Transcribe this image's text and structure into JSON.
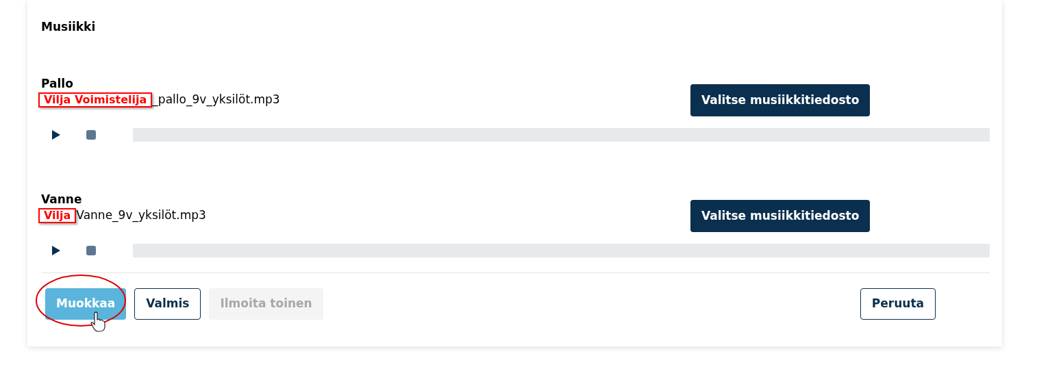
{
  "section_title": "Musiikki",
  "tracks": [
    {
      "label": "Pallo",
      "file_name": "_pallo_9v_yksilöt.mp3",
      "annotation": "Vilja Voimistelija",
      "choose_button": "Valitse musiikkitiedosto"
    },
    {
      "label": "Vanne",
      "file_name": "Vanne_9v_yksilöt.mp3",
      "annotation": "Vilja",
      "choose_button": "Valitse musiikkitiedosto"
    }
  ],
  "actions": [
    {
      "label": "Muokkaa",
      "kind": "primary",
      "highlighted": true
    },
    {
      "label": "Valmis",
      "kind": "outline",
      "highlighted": false
    },
    {
      "label": "Ilmoita toinen",
      "kind": "disabled",
      "highlighted": false
    }
  ],
  "cancel_button": "Peruuta"
}
